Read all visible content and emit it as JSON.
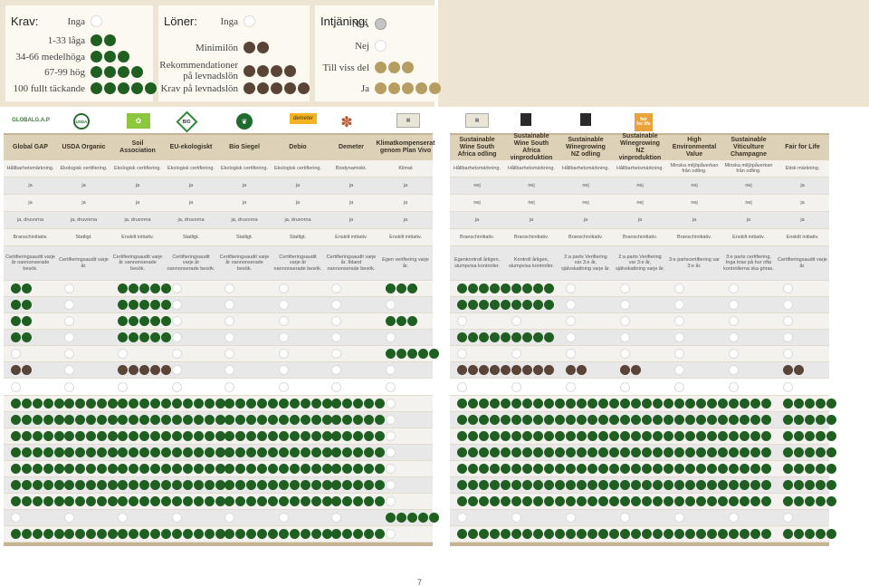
{
  "legend": {
    "krav": {
      "title": "Krav:",
      "rows": [
        {
          "label": "Inga",
          "n": 0
        },
        {
          "label": "1-33 låga",
          "n": 2
        },
        {
          "label": "34-66 medelhöga",
          "n": 3
        },
        {
          "label": "67-99 hög",
          "n": 4
        },
        {
          "label": "100 fullt täckande",
          "n": 5
        }
      ]
    },
    "loner": {
      "title": "Löner:",
      "rows": [
        {
          "label": "Inga",
          "n": 0
        },
        {
          "label": "Minimilön",
          "n": 2
        },
        {
          "label": "Rekommendationer på levnadslön",
          "n": 4
        },
        {
          "label": "Krav på levnadslön",
          "n": 5
        }
      ]
    },
    "intjaning": {
      "title": "Intjäning:",
      "rows": [
        {
          "label": "N/A",
          "n": 1,
          "kind": "gr"
        },
        {
          "label": "Nej",
          "n": 0
        },
        {
          "label": "Till viss del",
          "n": 3,
          "kind": "o"
        },
        {
          "label": "Ja",
          "n": 5,
          "kind": "o"
        }
      ]
    }
  },
  "logos": [
    {
      "name": "globalgap-logo",
      "text": "GLOBALG.A.P",
      "color": "#3d7c3a"
    },
    {
      "name": "usda-organic-logo",
      "text": "USDA",
      "color": "#2f6b2f"
    },
    {
      "name": "eu-organic-logo",
      "text": "",
      "color": "#8cc63f"
    },
    {
      "name": "bio-siegel-logo",
      "text": "BIO",
      "color": "#2b2b2b"
    },
    {
      "name": "debio-logo",
      "text": "",
      "color": "#1f6b2f"
    },
    {
      "name": "demeter-logo",
      "text": "demeter",
      "color": "#f2b420"
    },
    {
      "name": "klimat-logo",
      "text": "",
      "color": "#b5562d"
    },
    {
      "name": "swsa-logo-1",
      "text": "",
      "color": "#8a8a6a"
    },
    {
      "name": "swsa-logo-2",
      "text": "",
      "color": "#8a8a6a"
    },
    {
      "name": "swnz-logo-1",
      "text": "",
      "color": "#2a2a2a"
    },
    {
      "name": "swnz-logo-2",
      "text": "",
      "color": "#2a2a2a"
    },
    {
      "name": "fair-for-life-logo",
      "text": "fair for life",
      "color": "#e8a33a"
    }
  ],
  "table": {
    "columns": [
      "Global GAP",
      "USDA Organic",
      "Soil Association",
      "EU-ekologiskt",
      "Bio Siegel",
      "Debio",
      "Demeter",
      "Klimatkompenserat genom Plan Vivo",
      "Sustainable Wine South Africa odling",
      "Sustainable Wine South Africa vinproduktion",
      "Sustainable Winegrowing NZ odling",
      "Sustainable Winegrowing NZ vinproduktion",
      "High Environmental Value",
      "Sustainable Viticulture Champagne",
      "Fair for Life"
    ],
    "text_rows": [
      [
        "Hållbarhetsmärkning.",
        "Ekologisk certifiering.",
        "Ekologisk certifiering.",
        "Ekologisk certifiering.",
        "Ekologisk certifiering.",
        "Ekologisk certifiering.",
        "Biodynamiskt.",
        "Klimat",
        "Hållbarhetsmärkning.",
        "Hållbarhetsmärkning.",
        "Hållbarhetsmärkning.",
        "Hållbarhetsmärkning.",
        "Minska miljöpåverkan från odling.",
        "Minska miljöpåverkan från odling.",
        "Etisk märkning."
      ],
      [
        "ja",
        "ja",
        "ja",
        "ja",
        "ja",
        "ja",
        "ja",
        "ja",
        "nej",
        "nej",
        "nej",
        "nej",
        "nej",
        "nej",
        "ja"
      ],
      [
        "ja",
        "ja",
        "ja",
        "ja",
        "ja",
        "ja",
        "ja",
        "ja",
        "nej",
        "nej",
        "nej",
        "nej",
        "nej",
        "nej",
        "ja"
      ],
      [
        "ja, druvorna",
        "ja, druvorna",
        "ja, druvorna",
        "ja, druvorna",
        "ja, druvorna",
        "ja, druvorna",
        "ja",
        "ja",
        "ja",
        "ja",
        "ja",
        "ja",
        "ja",
        "ja",
        "ja"
      ],
      [
        "Branschinitiativ.",
        "Statligt.",
        "Enskilt initiativ.",
        "Statligt.",
        "Statligt.",
        "Statligt.",
        "Enskilt initiativ.",
        "Enskilt initiativ.",
        "Branschinitiativ.",
        "Branschinitiativ.",
        "Branschinitiativ.",
        "Branschinitiativ.",
        "Branschinitiativ.",
        "Enskilt initiativ.",
        "Enskilt initiativ."
      ],
      [
        "Certifieringsaudit varje år oannonserade besök.",
        "Certifieringsaudit varje år.",
        "Certifieringsaudit varje år oannonserade besök.",
        "Certifieringsaudit varje år oannonserade besök.",
        "Certifieringsaudit varje år oannonserade besök.",
        "Certifieringsaudit varje år oannonserade besök.",
        "Certifieringsaudit varje år. Ibland oannonserade besök.",
        "Egen verifiering varje år.",
        "Egenkontroll årligen, slumpvisa kontroller.",
        "Kontroll årligen, slumpvisa kontroller.",
        "2:a parts Verifiering var 3:e år, självskattning varje år.",
        "2:a parts Verifiering var 3:e år, självskattning varje år.",
        "3:e partscertifiering var 3:e år.",
        "3:e parts certifiering, Inga krav på hur ofta kontrollerna ska göras.",
        "Certifieringsaudit varje år."
      ]
    ],
    "dot_rows": [
      [
        [
          2,
          "g"
        ],
        [
          0
        ],
        [
          5,
          "g"
        ],
        [
          0
        ],
        [
          0
        ],
        [
          0
        ],
        [
          0
        ],
        [
          3,
          "g"
        ],
        [
          5,
          "g"
        ],
        [
          4,
          "g"
        ],
        [
          0
        ],
        [
          0
        ],
        [
          0
        ],
        [
          0
        ],
        [
          0
        ]
      ],
      [
        [
          2,
          "g"
        ],
        [
          0
        ],
        [
          5,
          "g"
        ],
        [
          0
        ],
        [
          0
        ],
        [
          0
        ],
        [
          0
        ],
        [
          0
        ],
        [
          5,
          "g"
        ],
        [
          4,
          "g"
        ],
        [
          0
        ],
        [
          0
        ],
        [
          0
        ],
        [
          0
        ],
        [
          0
        ]
      ],
      [
        [
          2,
          "g"
        ],
        [
          0
        ],
        [
          5,
          "g"
        ],
        [
          0
        ],
        [
          0
        ],
        [
          0
        ],
        [
          0
        ],
        [
          3,
          "g"
        ],
        [
          0
        ],
        [
          0
        ],
        [
          0
        ],
        [
          0
        ],
        [
          0
        ],
        [
          0
        ],
        [
          0
        ]
      ],
      [
        [
          2,
          "g"
        ],
        [
          0
        ],
        [
          5,
          "g"
        ],
        [
          0
        ],
        [
          0
        ],
        [
          0
        ],
        [
          0
        ],
        [
          0
        ],
        [
          5,
          "g"
        ],
        [
          4,
          "g"
        ],
        [
          0
        ],
        [
          0
        ],
        [
          0
        ],
        [
          0
        ],
        [
          0
        ]
      ],
      [
        [
          0
        ],
        [
          0
        ],
        [
          0
        ],
        [
          0
        ],
        [
          0
        ],
        [
          0
        ],
        [
          0
        ],
        [
          5,
          "g"
        ],
        [
          0
        ],
        [
          0
        ],
        [
          0
        ],
        [
          0
        ],
        [
          0
        ],
        [
          0
        ],
        [
          0
        ]
      ],
      [
        [
          2,
          "b"
        ],
        [
          0
        ],
        [
          5,
          "b"
        ],
        [
          0
        ],
        [
          0
        ],
        [
          0
        ],
        [
          0
        ],
        [
          0
        ],
        [
          5,
          "b"
        ],
        [
          4,
          "b"
        ],
        [
          2,
          "b"
        ],
        [
          2,
          "b"
        ],
        [
          0
        ],
        [
          0
        ],
        [
          2,
          "b"
        ]
      ],
      [
        [
          0
        ],
        [
          0
        ],
        [
          0
        ],
        [
          0
        ],
        [
          0
        ],
        [
          0
        ],
        [
          0
        ],
        [
          0
        ],
        [
          0
        ],
        [
          0
        ],
        [
          0
        ],
        [
          0
        ],
        [
          0
        ],
        [
          0
        ],
        [
          0
        ]
      ],
      [
        [
          5,
          "g"
        ],
        [
          5,
          "g"
        ],
        [
          5,
          "g"
        ],
        [
          5,
          "g"
        ],
        [
          5,
          "g"
        ],
        [
          5,
          "g"
        ],
        [
          5,
          "g"
        ],
        [
          0
        ],
        [
          5,
          "g"
        ],
        [
          5,
          "g"
        ],
        [
          5,
          "g"
        ],
        [
          5,
          "g"
        ],
        [
          5,
          "g"
        ],
        [
          4,
          "g"
        ],
        [
          5,
          "g"
        ]
      ],
      [
        [
          5,
          "g"
        ],
        [
          5,
          "g"
        ],
        [
          5,
          "g"
        ],
        [
          5,
          "g"
        ],
        [
          5,
          "g"
        ],
        [
          5,
          "g"
        ],
        [
          5,
          "g"
        ],
        [
          0
        ],
        [
          5,
          "g"
        ],
        [
          5,
          "g"
        ],
        [
          5,
          "g"
        ],
        [
          5,
          "g"
        ],
        [
          5,
          "g"
        ],
        [
          4,
          "g"
        ],
        [
          5,
          "g"
        ]
      ],
      [
        [
          5,
          "g"
        ],
        [
          5,
          "g"
        ],
        [
          5,
          "g"
        ],
        [
          5,
          "g"
        ],
        [
          5,
          "g"
        ],
        [
          5,
          "g"
        ],
        [
          5,
          "g"
        ],
        [
          0
        ],
        [
          5,
          "g"
        ],
        [
          5,
          "g"
        ],
        [
          5,
          "g"
        ],
        [
          5,
          "g"
        ],
        [
          5,
          "g"
        ],
        [
          4,
          "g"
        ],
        [
          5,
          "g"
        ]
      ],
      [
        [
          5,
          "g"
        ],
        [
          5,
          "g"
        ],
        [
          5,
          "g"
        ],
        [
          5,
          "g"
        ],
        [
          5,
          "g"
        ],
        [
          5,
          "g"
        ],
        [
          5,
          "g"
        ],
        [
          0
        ],
        [
          5,
          "g"
        ],
        [
          5,
          "g"
        ],
        [
          5,
          "g"
        ],
        [
          5,
          "g"
        ],
        [
          5,
          "g"
        ],
        [
          4,
          "g"
        ],
        [
          5,
          "g"
        ]
      ],
      [
        [
          5,
          "g"
        ],
        [
          5,
          "g"
        ],
        [
          5,
          "g"
        ],
        [
          5,
          "g"
        ],
        [
          5,
          "g"
        ],
        [
          5,
          "g"
        ],
        [
          5,
          "g"
        ],
        [
          0
        ],
        [
          5,
          "g"
        ],
        [
          5,
          "g"
        ],
        [
          5,
          "g"
        ],
        [
          5,
          "g"
        ],
        [
          5,
          "g"
        ],
        [
          4,
          "g"
        ],
        [
          5,
          "g"
        ]
      ],
      [
        [
          5,
          "g"
        ],
        [
          5,
          "g"
        ],
        [
          5,
          "g"
        ],
        [
          5,
          "g"
        ],
        [
          5,
          "g"
        ],
        [
          5,
          "g"
        ],
        [
          5,
          "g"
        ],
        [
          0
        ],
        [
          5,
          "g"
        ],
        [
          5,
          "g"
        ],
        [
          5,
          "g"
        ],
        [
          5,
          "g"
        ],
        [
          5,
          "g"
        ],
        [
          4,
          "g"
        ],
        [
          5,
          "g"
        ]
      ],
      [
        [
          5,
          "g"
        ],
        [
          5,
          "g"
        ],
        [
          5,
          "g"
        ],
        [
          5,
          "g"
        ],
        [
          5,
          "g"
        ],
        [
          5,
          "g"
        ],
        [
          5,
          "g"
        ],
        [
          0
        ],
        [
          5,
          "g"
        ],
        [
          5,
          "g"
        ],
        [
          5,
          "g"
        ],
        [
          5,
          "g"
        ],
        [
          5,
          "g"
        ],
        [
          4,
          "g"
        ],
        [
          5,
          "g"
        ]
      ],
      [
        [
          0
        ],
        [
          0
        ],
        [
          0
        ],
        [
          0
        ],
        [
          0
        ],
        [
          0
        ],
        [
          0
        ],
        [
          5,
          "g"
        ],
        [
          0
        ],
        [
          0
        ],
        [
          0
        ],
        [
          0
        ],
        [
          0
        ],
        [
          0
        ],
        [
          0
        ]
      ],
      [
        [
          5,
          "g"
        ],
        [
          5,
          "g"
        ],
        [
          5,
          "g"
        ],
        [
          5,
          "g"
        ],
        [
          5,
          "g"
        ],
        [
          5,
          "g"
        ],
        [
          5,
          "g"
        ],
        [
          0
        ],
        [
          5,
          "g"
        ],
        [
          5,
          "g"
        ],
        [
          5,
          "g"
        ],
        [
          5,
          "g"
        ],
        [
          5,
          "g"
        ],
        [
          4,
          "g"
        ],
        [
          5,
          "g"
        ]
      ]
    ]
  },
  "page_number": "7",
  "colors": {
    "green": "#1f5f21",
    "brown": "#5a4438",
    "ochre": "#b69e62",
    "header_bg": "#ddd1b7",
    "legend_bg": "#ede4d3"
  }
}
